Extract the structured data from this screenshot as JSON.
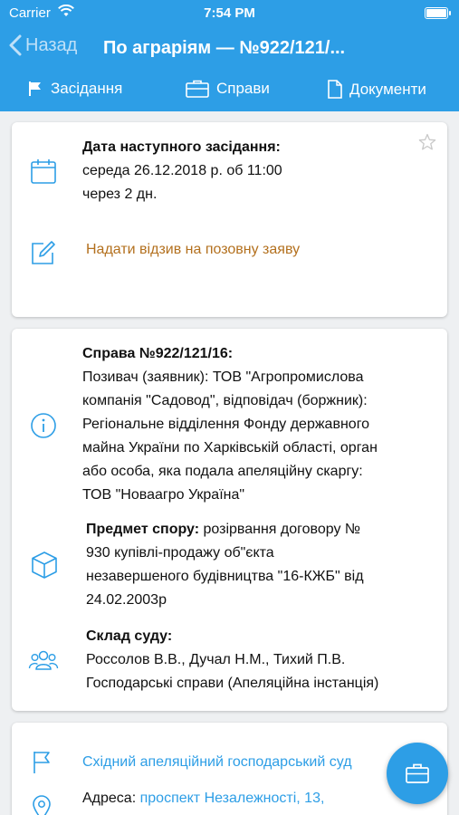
{
  "status_bar": {
    "carrier": "Carrier",
    "time": "7:54 PM"
  },
  "nav": {
    "back_label": "Назад",
    "title": "По аграріям — №922/121/..."
  },
  "tabs": [
    {
      "label": "Засідання",
      "icon": "flag-icon"
    },
    {
      "label": "Справи",
      "icon": "briefcase-icon"
    },
    {
      "label": "Документи",
      "icon": "document-icon"
    }
  ],
  "hearing": {
    "heading": "Дата наступного засідання:",
    "date_line": "середа 26.12.2018 р. об 11:00",
    "relative": "через 2 дн.",
    "action_link": "Надати відзив на позовну заяву"
  },
  "case": {
    "heading": "Справа №922/121/16:",
    "parties_l1": "Позивач (заявник): ТОВ \"Агропромислова",
    "parties_l2": "компанія \"Садовод\", відповідач (боржник):",
    "parties_l3": "Регіональне відділення Фонду державного",
    "parties_l4": "майна України по Харківській області, орган",
    "parties_l5": "або особа, яка подала апеляційну скаргу:",
    "parties_l6": "ТОВ \"Новаагро Україна\"",
    "subject_label": "Предмет спору:",
    "subject_l1": " розірвання договору №",
    "subject_l2": "930 купівлі-продажу об\"єкта",
    "subject_l3": "незавершеного будівництва \"16-КЖБ\" від",
    "subject_l4": "24.02.2003р",
    "court_heading": "Склад суду:",
    "judges": "Россолов В.В., Дучал Н.М., Тихий П.В.",
    "court_type": "Господарські справи (Апеляційна інстанція)"
  },
  "court": {
    "name": "Східний апеляційний господарський суд",
    "address_label": "Адреса:",
    "address_value": " проспект Незалежності, 13,"
  },
  "colors": {
    "primary": "#2d9ee6",
    "orange_link": "#b3701e"
  }
}
